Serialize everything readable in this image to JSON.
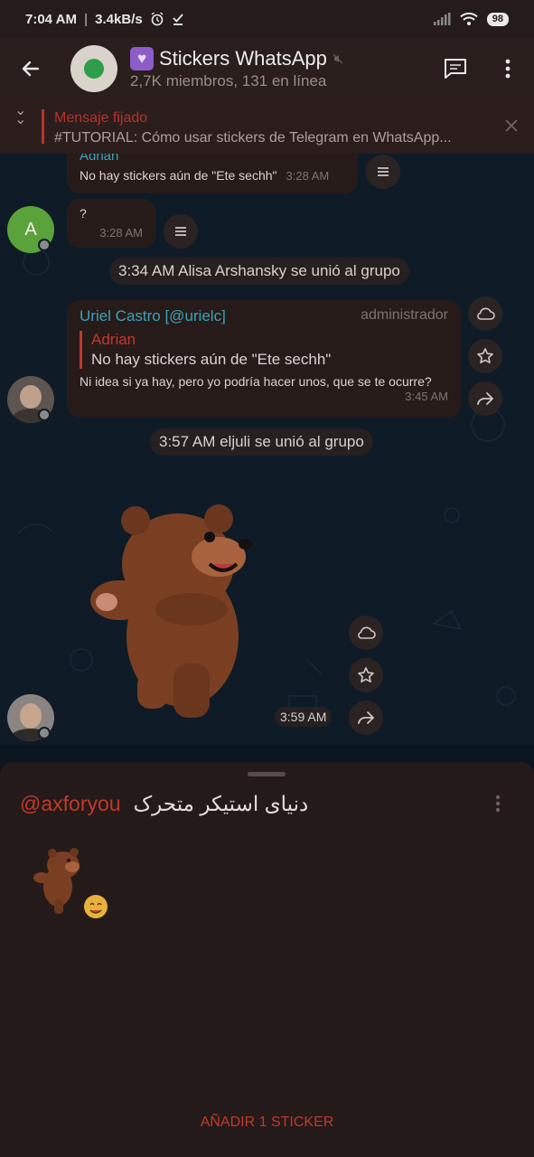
{
  "status_bar": {
    "time": "7:04 AM",
    "speed": "3.4kB/s",
    "battery": "98"
  },
  "header": {
    "title": "Stickers WhatsApp",
    "subtitle": "2,7K miembros, 131 en línea"
  },
  "pinned": {
    "label": "Mensaje fijado",
    "text": "#TUTORIAL: Cómo usar stickers de Telegram en WhatsApp..."
  },
  "messages": {
    "m1": {
      "sender": "Adrian",
      "text": "No hay stickers aún de \"Ete sechh\"",
      "time": "3:28 AM"
    },
    "m2": {
      "avatar_letter": "A",
      "text": "?",
      "time": "3:28 AM"
    },
    "service1": "3:34 AM Alisa Arshansky se unió al grupo",
    "m3": {
      "sender": "Uriel Castro [@urielc]",
      "role": "administrador",
      "reply_name": "Adrian",
      "reply_text": "No hay stickers aún de \"Ete sechh\"",
      "text": "Ni idea si ya hay, pero yo podría hacer unos, que se te ocurre?",
      "time": "3:45 AM"
    },
    "service2": "3:57 AM eljuli se unió al grupo",
    "sticker": {
      "time": "3:59 AM"
    }
  },
  "sticker_sheet": {
    "title_rtl": "دنیای استیکر متحرک",
    "handle": "@axforyou",
    "add_button": "AÑADIR 1 STICKER"
  },
  "colors": {
    "accent": "#c0392b",
    "header_bg": "#2a1e1c",
    "chat_bg": "#0e1b27",
    "sender_name": "#3aa3b8"
  }
}
